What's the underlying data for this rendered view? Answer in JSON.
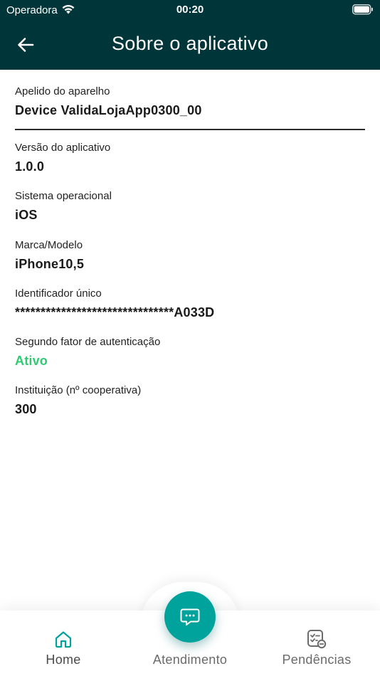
{
  "status_bar": {
    "carrier": "Operadora",
    "time": "00:20"
  },
  "header": {
    "title": "Sobre o aplicativo"
  },
  "fields": [
    {
      "label": "Apelido do aparelho",
      "value": "Device ValidaLojaApp0300_00"
    },
    {
      "label": "Versão do aplicativo",
      "value": "1.0.0"
    },
    {
      "label": "Sistema operacional",
      "value": "iOS"
    },
    {
      "label": "Marca/Modelo",
      "value": "iPhone10,5"
    },
    {
      "label": "Identificador único",
      "value": "*******************************A033D"
    },
    {
      "label": "Segundo fator de autenticação",
      "value": "Ativo"
    },
    {
      "label": "Instituição (nº cooperativa)",
      "value": "300"
    }
  ],
  "bottom_nav": {
    "items": [
      {
        "label": "Home",
        "icon": "home-icon"
      },
      {
        "label": "Atendimento",
        "icon": "chat-icon"
      },
      {
        "label": "Pendências",
        "icon": "pending-icon"
      }
    ]
  },
  "colors": {
    "header_bg": "#00353a",
    "accent": "#00a39b",
    "status_ok": "#2ecc71"
  }
}
